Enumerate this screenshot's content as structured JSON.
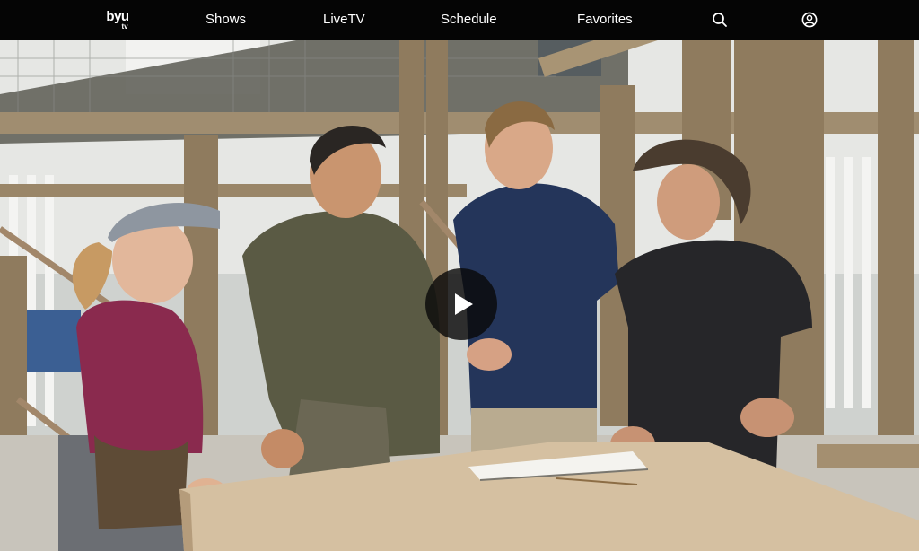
{
  "app": {
    "logo_main": "byu",
    "logo_sub": "tv"
  },
  "nav": {
    "shows": "Shows",
    "livetv": "LiveTV",
    "schedule": "Schedule",
    "favorites": "Favorites",
    "search_icon": "search-icon",
    "account_icon": "account-icon"
  },
  "player": {
    "play_icon": "play-icon",
    "state": "paused"
  },
  "colors": {
    "navbar_bg": "#050505",
    "nav_text": "#ffffff",
    "play_button_bg": "#0a0a0a"
  }
}
